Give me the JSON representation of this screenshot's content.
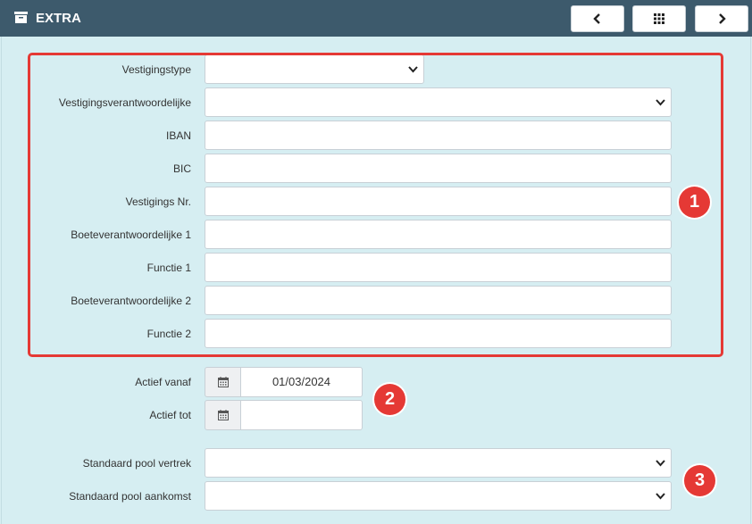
{
  "header": {
    "title": "EXTRA",
    "icons": {
      "title": "archive-box-icon",
      "prev": "chevron-left-icon",
      "grid": "grid-icon",
      "next": "chevron-right-icon"
    },
    "colors": {
      "bar": "#3d5a6c",
      "background": "#d6eef2",
      "annotation": "#e53935"
    }
  },
  "form": {
    "vestigingstype": {
      "label": "Vestigingstype",
      "value": ""
    },
    "verantwoordelijke": {
      "label": "Vestigingsverantwoordelijke",
      "value": ""
    },
    "iban": {
      "label": "IBAN",
      "value": ""
    },
    "bic": {
      "label": "BIC",
      "value": ""
    },
    "vestigings_nr": {
      "label": "Vestigings Nr.",
      "value": ""
    },
    "boete1": {
      "label": "Boeteverantwoordelijke 1",
      "value": ""
    },
    "functie1": {
      "label": "Functie 1",
      "value": ""
    },
    "boete2": {
      "label": "Boeteverantwoordelijke 2",
      "value": ""
    },
    "functie2": {
      "label": "Functie 2",
      "value": ""
    },
    "actief_vanaf": {
      "label": "Actief vanaf",
      "value": "01/03/2024"
    },
    "actief_tot": {
      "label": "Actief tot",
      "value": ""
    },
    "pool_vertrek": {
      "label": "Standaard pool vertrek",
      "value": ""
    },
    "pool_aankomst": {
      "label": "Standaard pool aankomst",
      "value": ""
    }
  },
  "annotations": {
    "badge1": "1",
    "badge2": "2",
    "badge3": "3"
  }
}
